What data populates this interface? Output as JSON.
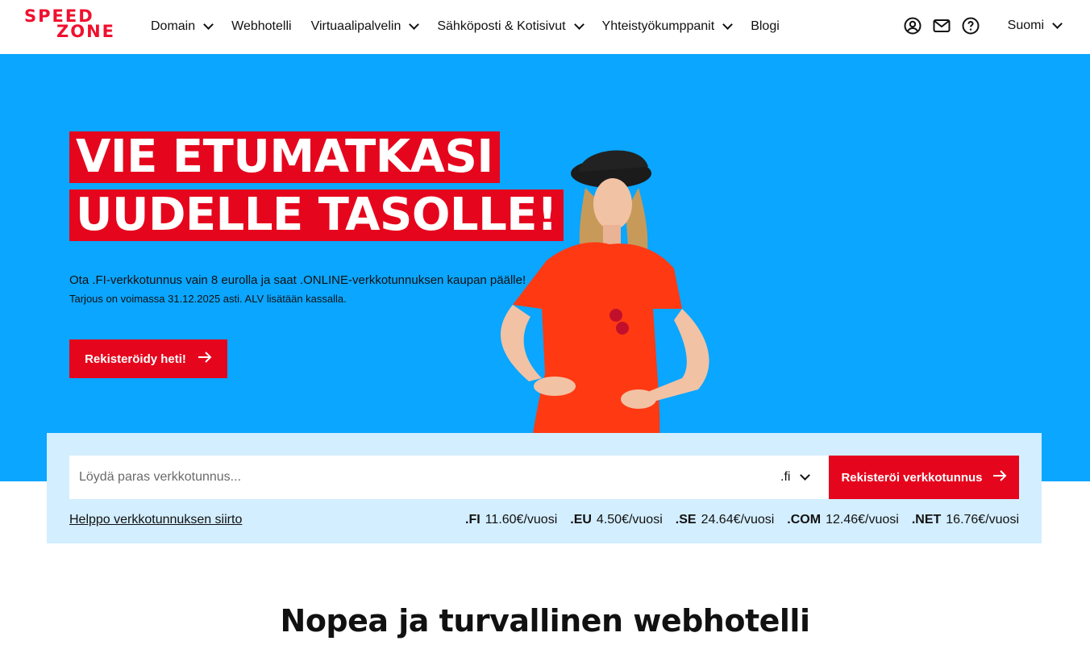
{
  "header": {
    "logo_line1": "SPEED",
    "logo_line2": "ZONE",
    "nav": [
      {
        "label": "Domain",
        "has_dropdown": true
      },
      {
        "label": "Webhotelli",
        "has_dropdown": false
      },
      {
        "label": "Virtuaalipalvelin",
        "has_dropdown": true
      },
      {
        "label": "Sähköposti & Kotisivut",
        "has_dropdown": true
      },
      {
        "label": "Yhteistyökumppanit",
        "has_dropdown": true
      },
      {
        "label": "Blogi",
        "has_dropdown": false
      }
    ],
    "icons": [
      "user-icon",
      "mail-icon",
      "help-icon"
    ],
    "language": "Suomi"
  },
  "hero": {
    "headline_line1": "VIE ETUMATKASI",
    "headline_line2": "UUDELLE TASOLLE!",
    "text": "Ota .FI-verkkotunnus vain 8 eurolla ja saat .ONLINE-verkkotunnuksen kaupan päälle!",
    "small_text": "Tarjous on voimassa 31.12.2025 asti. ALV lisätään kassalla.",
    "cta_label": "Rekisteröidy heti!"
  },
  "domain_search": {
    "placeholder": "Löydä paras verkkotunnus...",
    "value": "",
    "tld_selected": ".fi",
    "register_label": "Rekisteröi verkkotunnus",
    "transfer_link": "Helppo verkkotunnuksen siirto",
    "prices": [
      {
        "tld": ".FI",
        "price": "11.60€/vuosi"
      },
      {
        "tld": ".EU",
        "price": "4.50€/vuosi"
      },
      {
        "tld": ".SE",
        "price": "24.64€/vuosi"
      },
      {
        "tld": ".COM",
        "price": "12.46€/vuosi"
      },
      {
        "tld": ".NET",
        "price": "16.76€/vuosi"
      }
    ]
  },
  "section": {
    "title": "Nopea ja turvallinen webhotelli"
  },
  "colors": {
    "brand_red": "#e5061d",
    "hero_blue": "#0aa6ff",
    "panel_blue": "#d3eeff"
  }
}
